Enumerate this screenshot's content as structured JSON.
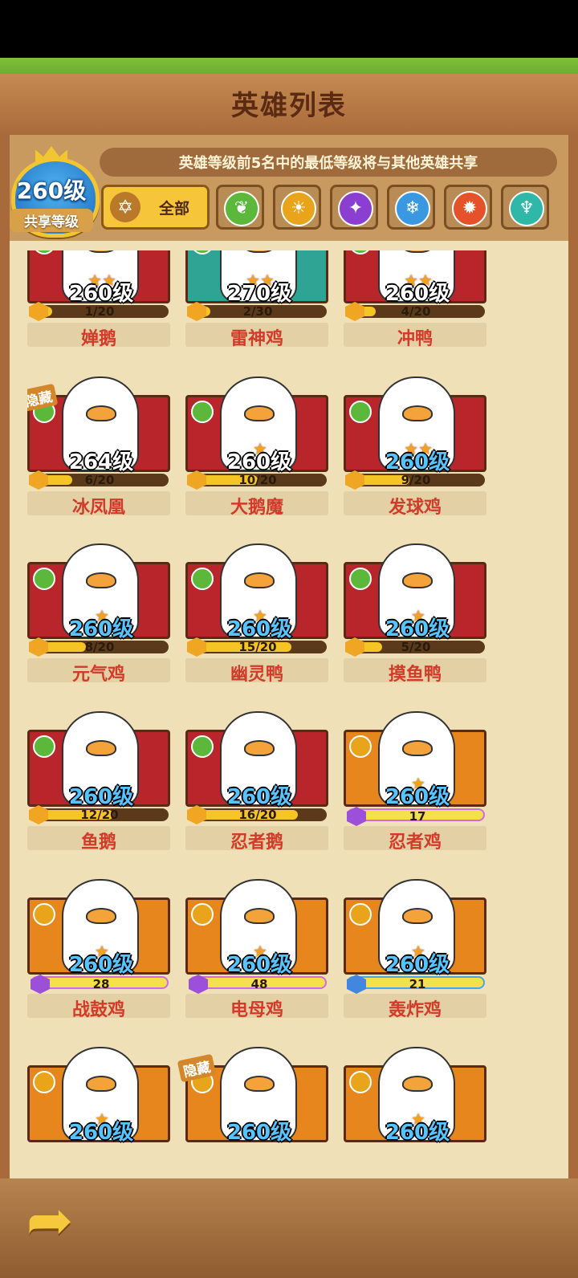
{
  "title": "英雄列表",
  "share": {
    "level": "260级",
    "label": "共享等级"
  },
  "info_text": "英雄等级前5名中的最低等级将与其他英雄共享",
  "filters": {
    "all_label": "全部",
    "elements": [
      {
        "icon": "leaf-icon",
        "color": "#5cb83a"
      },
      {
        "icon": "sun-icon",
        "color": "#e8a51c"
      },
      {
        "icon": "shadow-icon",
        "color": "#8a3fd1"
      },
      {
        "icon": "snowflake-icon",
        "color": "#3a98e2"
      },
      {
        "icon": "fire-icon",
        "color": "#e5522a"
      },
      {
        "icon": "wind-icon",
        "color": "#2fb7a8"
      }
    ]
  },
  "heroes": [
    {
      "name": "婵鹅",
      "level": "260级",
      "progress": "1/20",
      "fill": 0.05,
      "bg": "red",
      "stars": "★★",
      "level_color": "white"
    },
    {
      "name": "雷神鸡",
      "level": "270级",
      "progress": "2/30",
      "fill": 0.07,
      "bg": "teal",
      "stars": "★★",
      "level_color": "white"
    },
    {
      "name": "冲鸭",
      "level": "260级",
      "progress": "4/20",
      "fill": 0.2,
      "bg": "red",
      "stars": "★★",
      "level_color": "white"
    },
    {
      "name": "冰凤凰",
      "level": "264级",
      "progress": "6/20",
      "fill": 0.3,
      "bg": "red",
      "stars": "",
      "level_color": "white",
      "hidden_tag": "隐藏"
    },
    {
      "name": "大鹅魔",
      "level": "260级",
      "progress": "10/20",
      "fill": 0.5,
      "bg": "red",
      "stars": "★",
      "level_color": "white"
    },
    {
      "name": "发球鸡",
      "level": "260级",
      "progress": "9/20",
      "fill": 0.45,
      "bg": "red",
      "stars": "★★",
      "level_color": "blue"
    },
    {
      "name": "元气鸡",
      "level": "260级",
      "progress": "8/20",
      "fill": 0.4,
      "bg": "red",
      "stars": "★",
      "level_color": "blue"
    },
    {
      "name": "幽灵鸭",
      "level": "260级",
      "progress": "15/20",
      "fill": 0.75,
      "bg": "red",
      "stars": "★",
      "level_color": "blue"
    },
    {
      "name": "摸鱼鸭",
      "level": "260级",
      "progress": "5/20",
      "fill": 0.25,
      "bg": "red",
      "stars": "★",
      "level_color": "blue"
    },
    {
      "name": "鱼鹅",
      "level": "260级",
      "progress": "12/20",
      "fill": 0.6,
      "bg": "red",
      "stars": "",
      "level_color": "blue"
    },
    {
      "name": "忍者鹅",
      "level": "260级",
      "progress": "16/20",
      "fill": 0.8,
      "bg": "red",
      "stars": "",
      "level_color": "blue"
    },
    {
      "name": "忍者鸡",
      "level": "260级",
      "progress": "17",
      "fill": 1.0,
      "bg": "orange",
      "stars": "★",
      "level_color": "blue",
      "prog_style": "purple"
    },
    {
      "name": "战鼓鸡",
      "level": "260级",
      "progress": "28",
      "fill": 1.0,
      "bg": "orange",
      "stars": "★",
      "level_color": "blue",
      "prog_style": "purple"
    },
    {
      "name": "电母鸡",
      "level": "260级",
      "progress": "48",
      "fill": 1.0,
      "bg": "orange",
      "stars": "★",
      "level_color": "blue",
      "prog_style": "purple"
    },
    {
      "name": "轰炸鸡",
      "level": "260级",
      "progress": "21",
      "fill": 1.0,
      "bg": "orange",
      "stars": "★",
      "level_color": "blue",
      "prog_style": "blue"
    },
    {
      "name": "",
      "level": "260级",
      "progress": "",
      "fill": 0,
      "bg": "orange",
      "stars": "★",
      "level_color": "blue"
    },
    {
      "name": "",
      "level": "260级",
      "progress": "",
      "fill": 0,
      "bg": "orange",
      "stars": "",
      "level_color": "blue",
      "hidden_tag": "隐藏"
    },
    {
      "name": "",
      "level": "260级",
      "progress": "",
      "fill": 0,
      "bg": "orange",
      "stars": "★",
      "level_color": "blue"
    }
  ],
  "back_icon": "back-arrow-icon"
}
